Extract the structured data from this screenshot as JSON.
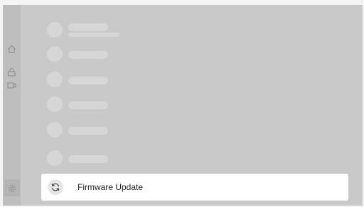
{
  "sidebar": {
    "items": [
      {
        "icon": "home-icon"
      },
      {
        "icon": "lock-icon"
      },
      {
        "icon": "camera-icon"
      },
      {
        "icon": "settings-icon",
        "active": true
      }
    ]
  },
  "list": {
    "firmware_item": {
      "label": "Firmware Update",
      "icon": "refresh-icon"
    }
  },
  "colors": {
    "overlay": "#c9c9c9",
    "sidebar": "#bebebe",
    "card": "#ffffff"
  }
}
